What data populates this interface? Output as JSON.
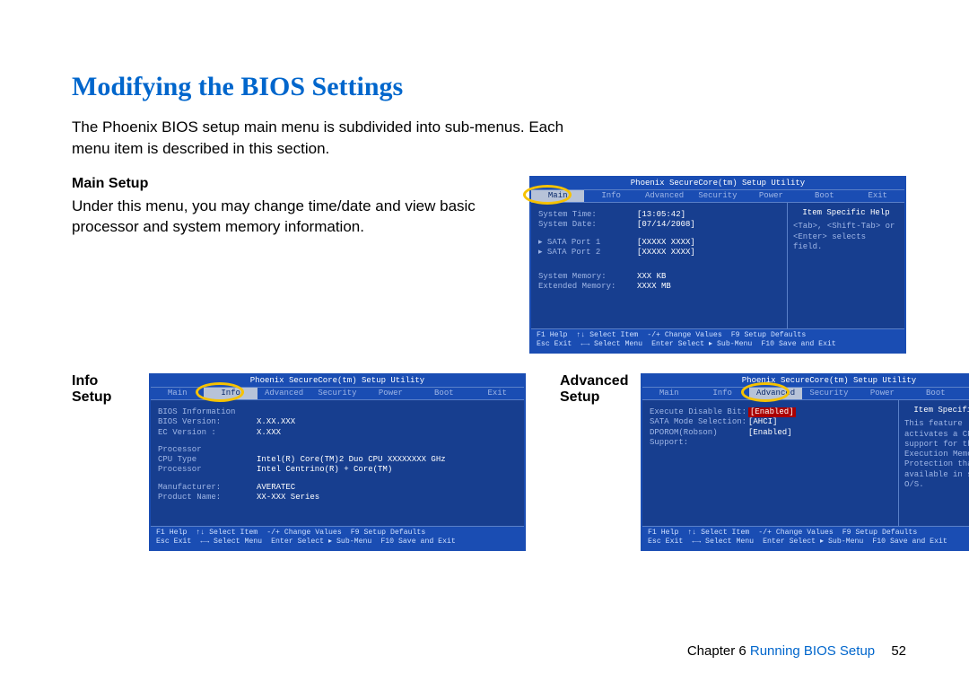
{
  "title": "Modifying the BIOS Settings",
  "intro": "The Phoenix BIOS setup main menu is subdivided into sub-menus. Each menu item is described in this section.",
  "sections": {
    "main": {
      "heading": "Main Setup",
      "body": "Under this menu, you may change time/date and view basic processor and system memory information."
    },
    "info": {
      "heading": "Info Setup"
    },
    "advanced": {
      "heading": "Advanced Setup"
    }
  },
  "bios_common": {
    "titlebar": "Phoenix SecureCore(tm) Setup Utility",
    "tabs": [
      "Main",
      "Info",
      "Advanced",
      "Security",
      "Power",
      "Boot",
      "Exit"
    ],
    "footer": {
      "f1": "F1  Help",
      "arrows_v": "↑↓  Select Item",
      "pm": "-/+  Change Values",
      "f9": "F9  Setup Defaults",
      "esc": "Esc Exit",
      "arrows_h": "←→  Select Menu",
      "enter": "Enter Select ▸ Sub-Menu",
      "f10": "F10 Save and Exit"
    },
    "help_head": "Item Specific Help"
  },
  "main_screen": {
    "rows": [
      {
        "k": "System Time:",
        "v": "[13:05:42]",
        "brk": true
      },
      {
        "k": "System Date:",
        "v": "[07/14/2008]"
      },
      {
        "spacer": true
      },
      {
        "k": "▸ SATA Port 1",
        "v": "[XXXXX XXXX]"
      },
      {
        "k": "▸ SATA Port 2",
        "v": "[XXXXX XXXX]"
      },
      {
        "spacer": true
      },
      {
        "spacer": true
      },
      {
        "k": "System Memory:",
        "v": "XXX KB"
      },
      {
        "k": "Extended Memory:",
        "v": "XXXX MB"
      }
    ],
    "help_body": "<Tab>, <Shift-Tab> or <Enter> selects field."
  },
  "info_screen": {
    "rows": [
      {
        "k": "BIOS Information",
        "v": ""
      },
      {
        "k": "BIOS Version:",
        "v": "X.XX.XXX"
      },
      {
        "k": "EC Version  :",
        "v": "X.XXX"
      },
      {
        "spacer": true
      },
      {
        "k": "Processor",
        "v": ""
      },
      {
        "k": "CPU Type",
        "v": "Intel(R) Core(TM)2 Duo CPU XXXXXXXX GHz"
      },
      {
        "k": "Processor",
        "v": "Intel Centrino(R) + Core(TM)"
      },
      {
        "spacer": true
      },
      {
        "k": "Manufacturer:",
        "v": "AVERATEC"
      },
      {
        "k": "Product Name:",
        "v": "XX-XXX Series"
      }
    ]
  },
  "advanced_screen": {
    "rows": [
      {
        "k": "Execute Disable Bit:",
        "v": "[Enabled]",
        "red": true
      },
      {
        "k": "SATA Mode Selection:",
        "v": "[AHCI]"
      },
      {
        "k": "DPOROM(Robson) Support:",
        "v": "[Enabled]"
      }
    ],
    "help_body": "This feature activates a CPU support for the No Execution Memory Protection that is available in some O/S."
  },
  "footer": {
    "chapter_label": "Chapter 6",
    "chapter_name": "Running BIOS Setup",
    "page": "52"
  }
}
